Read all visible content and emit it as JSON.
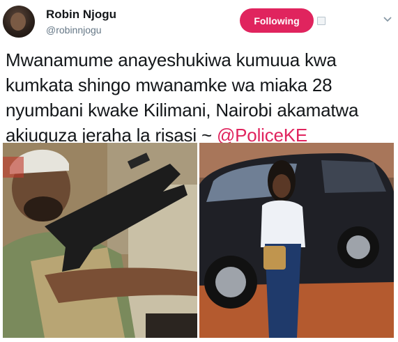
{
  "user": {
    "display_name": "Robin Njogu",
    "handle": "@robinnjogu"
  },
  "follow_button": {
    "label": "Following",
    "color": "#e0245e"
  },
  "tweet": {
    "lines": [
      "Mwanamume anayeshukiwa kumuua kwa",
      "kumkata shingo mwanamke wa miaka 28",
      "nyumbani kwake Kilimani, Nairobi akamatwa",
      "akiuguza jeraha la risasi ~ "
    ],
    "mention": "@PoliceKE",
    "mention_color": "#e0245e"
  },
  "icons": {
    "more": "chevron-down-icon",
    "extra": "small-square-icon"
  }
}
